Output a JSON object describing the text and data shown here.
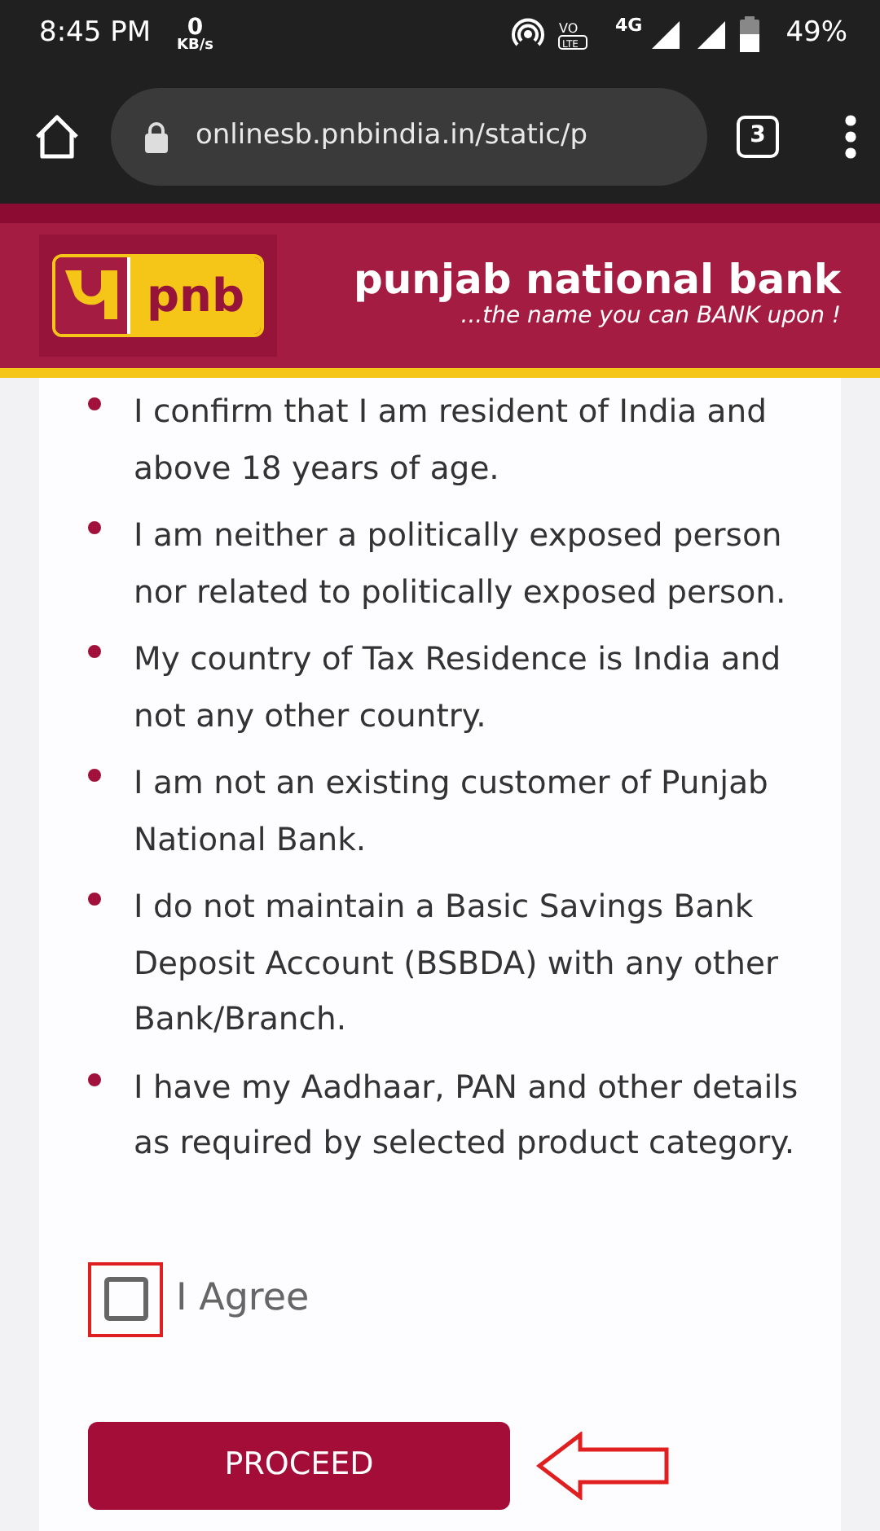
{
  "status_bar": {
    "time": "8:45 PM",
    "data_speed": "0",
    "data_unit": "KB/s",
    "volte_top": "VO",
    "volte_bottom": "LTE",
    "network": "4G",
    "battery": "49%"
  },
  "browser": {
    "url": "onlinesb.pnbindia.in/static/p",
    "tab_count": "3"
  },
  "banner": {
    "logo_text": "pnb",
    "bank_name": "punjab national bank",
    "tagline": "...the name you can BANK upon !"
  },
  "declarations": [
    "I confirm that I am resident of India and above 18 years of age.",
    "I am neither a politically exposed person nor related to politically exposed person.",
    "My country of Tax Residence is India and not any other country.",
    "I am not an existing customer of Punjab National Bank.",
    "I do not maintain a Basic Savings Bank Deposit Account (BSBDA) with any other Bank/Branch.",
    "I have my Aadhaar, PAN and other details as required by selected product category."
  ],
  "agree": {
    "label": "I Agree",
    "checked": false
  },
  "proceed_button": "PROCEED"
}
